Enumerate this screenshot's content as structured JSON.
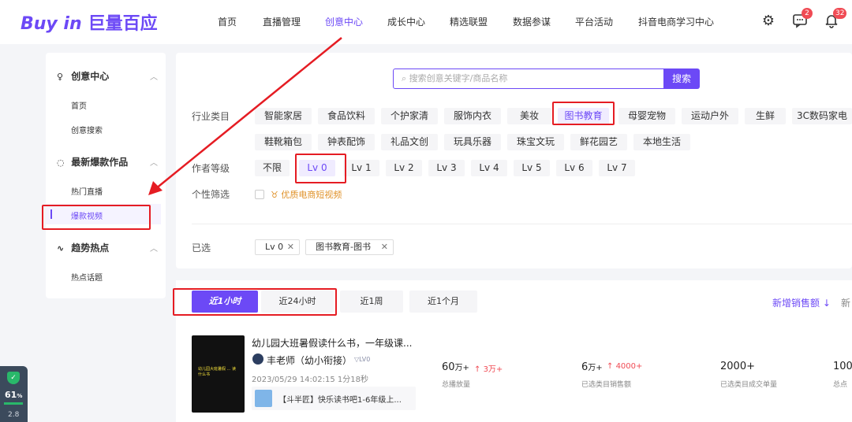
{
  "header": {
    "logo_en": "Buy in",
    "logo_cn": "巨量百应",
    "nav": [
      "首页",
      "直播管理",
      "创意中心",
      "成长中心",
      "精选联盟",
      "数据参谋",
      "平台活动",
      "抖音电商学习中心"
    ],
    "active_nav": "创意中心",
    "message_badge": "2",
    "notice_badge": "32"
  },
  "sidebar": {
    "groups": [
      {
        "label": "创意中心",
        "icon": "bulb-icon",
        "items": [
          "首页",
          "创意搜索"
        ]
      },
      {
        "label": "最新爆款作品",
        "icon": "fire-icon",
        "items": [
          "热门直播",
          "爆款视频"
        ]
      },
      {
        "label": "趋势热点",
        "icon": "trend-icon",
        "items": [
          "热点话题"
        ]
      }
    ],
    "active_item": "爆款视频"
  },
  "search": {
    "placeholder": "搜索创意关键字/商品名称",
    "button": "搜索"
  },
  "filters": {
    "industry_label": "行业类目",
    "industry": [
      "智能家居",
      "食品饮料",
      "个护家清",
      "服饰内衣",
      "美妆",
      "图书教育",
      "母婴宠物",
      "运动户外",
      "生鲜",
      "3C数码家电",
      "鞋靴箱包",
      "钟表配饰",
      "礼品文创",
      "玩具乐器",
      "珠宝文玩",
      "鲜花园艺",
      "本地生活"
    ],
    "industry_selected": "图书教育",
    "level_label": "作者等级",
    "levels": [
      "不限",
      "Lv 0",
      "Lv 1",
      "Lv 2",
      "Lv 3",
      "Lv 4",
      "Lv 5",
      "Lv 6",
      "Lv 7"
    ],
    "level_selected": "Lv 0",
    "personal_label": "个性筛选",
    "premium_option": "优质电商短视频",
    "selected_label": "已选",
    "selected_tags": [
      "Lv 0",
      "图书教育-图书"
    ]
  },
  "time_tabs": {
    "tabs": [
      "近1小时",
      "近24小时",
      "近1周",
      "近1个月"
    ],
    "selected": "近1小时",
    "sort_label": "新增销售额 ↓",
    "sort_next": "新"
  },
  "result": {
    "title": "幼儿园大班暑假读什么书，一年级课...",
    "author": "丰老师（幼小衔接）",
    "author_level": "LV0",
    "meta": "2023/05/29 14:02:15  1分18秒",
    "product": "【斗半匠】快乐读书吧1-6年级上...",
    "thumb_text": "幼儿园大班暑假 ... 读什么书",
    "metrics": [
      {
        "value": "60",
        "unit": "万+",
        "delta": "3万+",
        "label": "总播放量"
      },
      {
        "value": "6",
        "unit": "万+",
        "delta": "4000+",
        "label": "已选类目销售额"
      },
      {
        "value": "2000+",
        "unit": "",
        "delta": "",
        "label": "已选类目成交单量"
      },
      {
        "value": "100",
        "unit": "",
        "delta": "",
        "label": "总点"
      }
    ]
  },
  "widget": {
    "score": "61",
    "score_unit": "%",
    "value": "2.8"
  },
  "colors": {
    "brand": "#6c49f6",
    "annotation_red": "#e51c23",
    "badge_red": "#f04b54"
  }
}
